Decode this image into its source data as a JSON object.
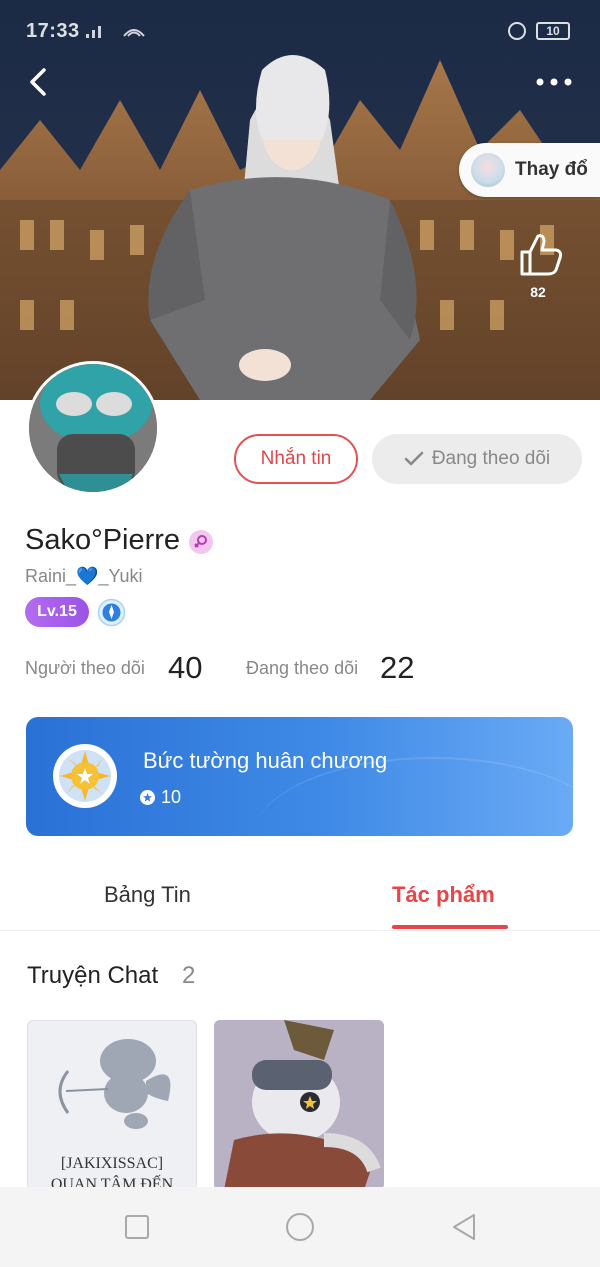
{
  "status_bar": {
    "time": "17:33",
    "battery": "10"
  },
  "hero": {
    "change_outfit_label": "Thay đổ",
    "like_count": "82"
  },
  "profile": {
    "message_button": "Nhắn tin",
    "following_button": "Đang theo dõi",
    "display_name": "Sako°Pierre",
    "username_prefix": "Raini_",
    "username_heart": "💙",
    "username_suffix": "_Yuki",
    "level": "Lv.15",
    "followers_label": "Người theo dõi",
    "followers_count": "40",
    "following_label": "Đang theo dõi",
    "following_count": "22"
  },
  "medal_wall": {
    "title": "Bức tường huân chương",
    "count": "10"
  },
  "tabs": [
    {
      "label": "Bảng Tin",
      "active": false
    },
    {
      "label": "Tác phẩm",
      "active": true
    }
  ],
  "chat_stories": {
    "title": "Truyện Chat",
    "count": "2",
    "cards": [
      {
        "cover_text_line1": "[JAKIXISSAC]",
        "cover_text_line2": "QUAN TÂM ĐẾN"
      },
      {
        "cover_text_line1": "",
        "cover_text_line2": ""
      }
    ]
  },
  "icons": {
    "back": "chevron-left-icon",
    "more": "more-dots-icon",
    "like": "thumbs-up-icon",
    "check": "check-icon",
    "gender": "female-symbol-icon",
    "rank": "rank-badge-icon",
    "medal": "sun-medal-icon",
    "nav_recent": "square-icon",
    "nav_home": "circle-icon",
    "nav_back": "triangle-back-icon"
  },
  "colors": {
    "accent_red": "#e74547",
    "medal_card_blue": "#2a71d6",
    "level_purple": "#a45ded",
    "following_bg": "#ececec"
  }
}
